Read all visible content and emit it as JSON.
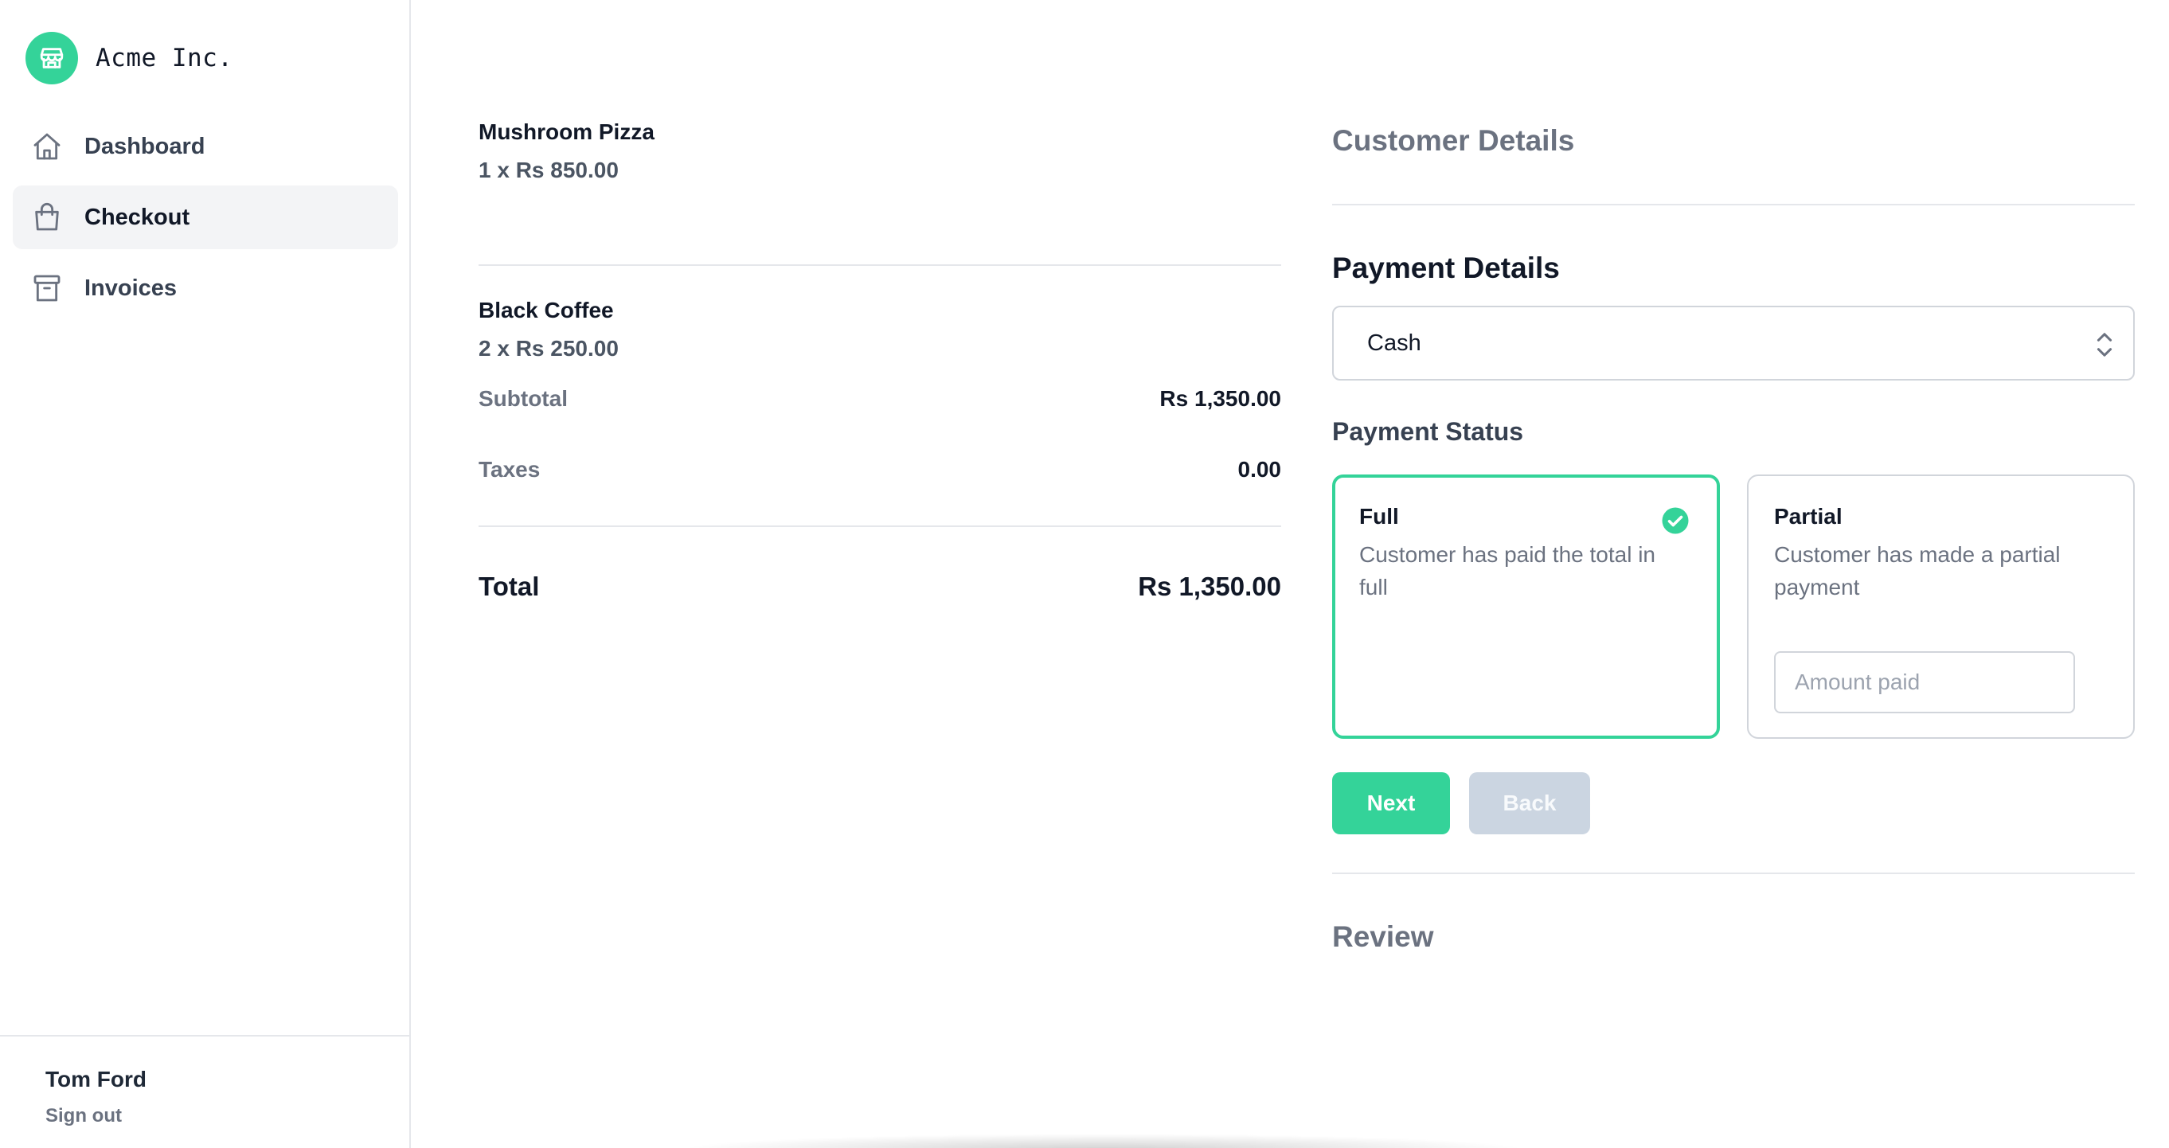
{
  "brand": {
    "name": "Acme Inc.",
    "icon": "store-icon",
    "color": "#34d399"
  },
  "sidebar": {
    "items": [
      {
        "label": "Dashboard",
        "icon": "home-icon",
        "active": false
      },
      {
        "label": "Checkout",
        "icon": "shopping-bag-icon",
        "active": true
      },
      {
        "label": "Invoices",
        "icon": "archive-icon",
        "active": false
      }
    ],
    "user": {
      "name": "Tom Ford",
      "sign_out": "Sign out"
    }
  },
  "order": {
    "items": [
      {
        "name": "Mushroom Pizza",
        "qty_price": "1 x Rs 850.00"
      },
      {
        "name": "Black Coffee",
        "qty_price": "2 x Rs 250.00"
      }
    ],
    "subtotal_label": "Subtotal",
    "subtotal_value": "Rs 1,350.00",
    "taxes_label": "Taxes",
    "taxes_value": "0.00",
    "total_label": "Total",
    "total_value": "Rs 1,350.00"
  },
  "checkout": {
    "customer_details_title": "Customer Details",
    "payment_details_title": "Payment Details",
    "payment_method": {
      "selected": "Cash"
    },
    "payment_status_title": "Payment Status",
    "status_options": [
      {
        "title": "Full",
        "description": "Customer has paid the total in full",
        "selected": true
      },
      {
        "title": "Partial",
        "description": "Customer has made a partial payment",
        "selected": false
      }
    ],
    "amount_paid_placeholder": "Amount paid",
    "next_label": "Next",
    "back_label": "Back",
    "review_title": "Review"
  },
  "colors": {
    "accent": "#34d399",
    "disabled_button": "#cbd5e1"
  }
}
